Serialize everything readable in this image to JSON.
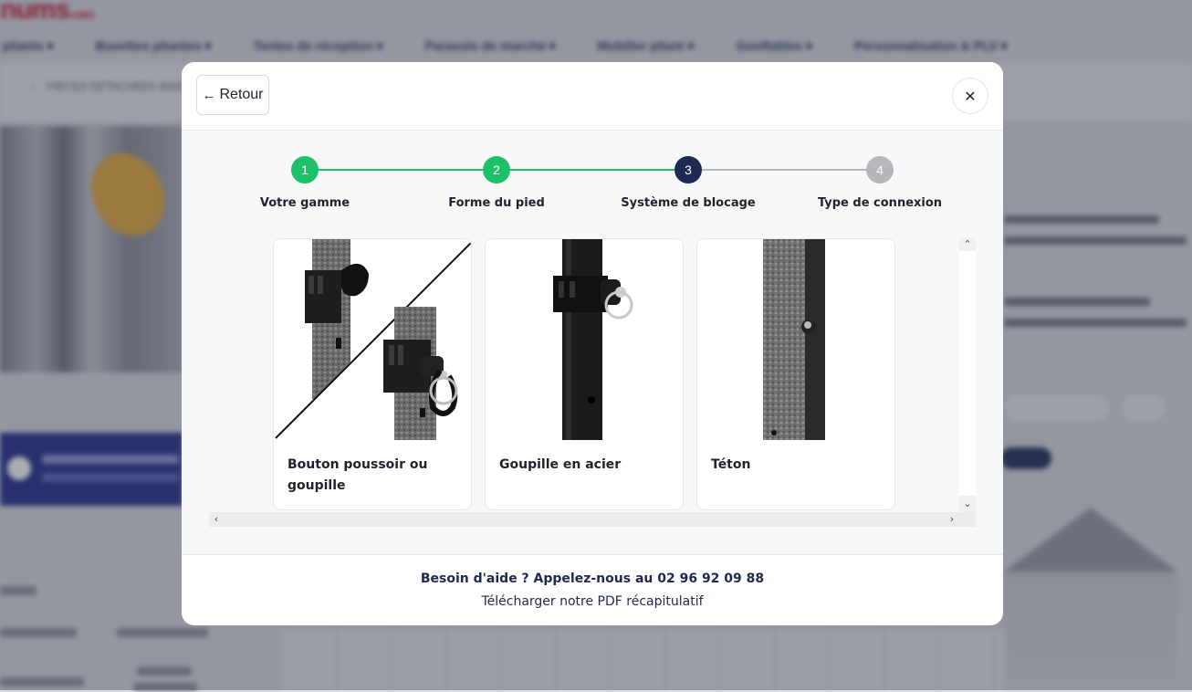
{
  "modal": {
    "back_label": "Retour",
    "close_symbol": "✕",
    "steps": [
      {
        "number": "1",
        "label": "Votre gamme",
        "status": "done",
        "color": "#1fc06a"
      },
      {
        "number": "2",
        "label": "Forme du pied",
        "status": "done",
        "color": "#1fc06a"
      },
      {
        "number": "3",
        "label": "Système de blocage",
        "status": "current",
        "color": "#1e2a55"
      },
      {
        "number": "4",
        "label": "Type de connexion",
        "status": "pending",
        "color": "#b5b7bd"
      }
    ],
    "options": [
      {
        "title": "Bouton poussoir ou goupille",
        "image": "split-push-button-and-pin-photo"
      },
      {
        "title": "Goupille en acier",
        "image": "steel-pin-photo"
      },
      {
        "title": "Téton",
        "image": "stud-photo"
      }
    ],
    "help_text": "Besoin d'aide ? Appelez-nous au 02 96 92 09 88",
    "pdf_link": "Télécharger notre PDF récapitulatif"
  },
  "colors": {
    "done": "#1fc06a",
    "current": "#1e2a55",
    "pending": "#b5b7bd",
    "text_dark": "#1e2a4f"
  }
}
